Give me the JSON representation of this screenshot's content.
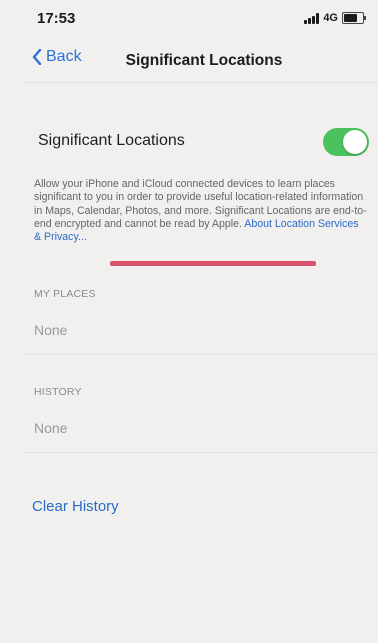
{
  "status_bar": {
    "time": "17:53",
    "network": "4G"
  },
  "nav": {
    "back_label": "Back",
    "title": "Significant Locations"
  },
  "toggle": {
    "label": "Significant Locations",
    "state": "on",
    "on_color": "#4cc25f"
  },
  "description": {
    "text": "Allow your iPhone and iCloud connected devices to learn places significant to you in order to provide useful location-related information in Maps, Calendar, Photos, and more. Significant Locations are end-to-end encrypted and cannot be read by Apple.",
    "link_label": "About Location Services & Privacy..."
  },
  "my_places": {
    "header": "MY PLACES",
    "value": "None"
  },
  "history": {
    "header": "HISTORY",
    "value": "None"
  },
  "actions": {
    "clear_history_label": "Clear History"
  },
  "colors": {
    "accent": "#2a6bc8",
    "annotation": "#d9506a"
  }
}
